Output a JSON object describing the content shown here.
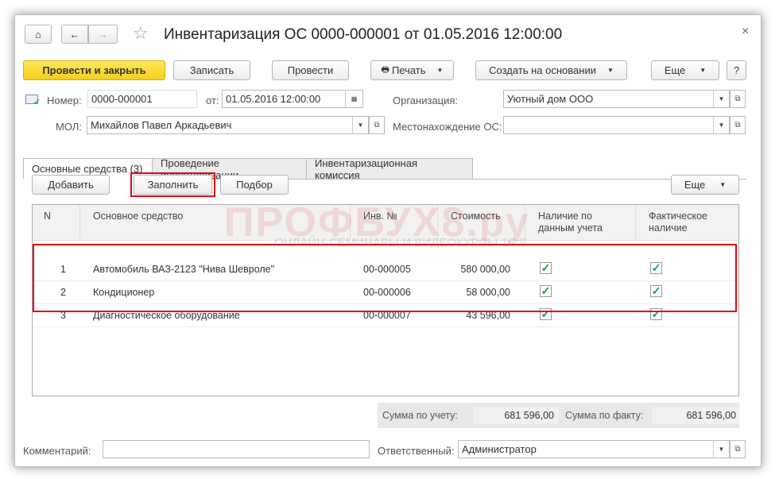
{
  "window": {
    "title": "Инвентаризация ОС 0000-000001 от 01.05.2016 12:00:00",
    "close": "×"
  },
  "toolbar": {
    "post_close": "Провести и закрыть",
    "save": "Записать",
    "post": "Провести",
    "print": "Печать",
    "create_based": "Создать на основании",
    "more": "Еще",
    "help": "?"
  },
  "header": {
    "number_label": "Номер:",
    "number": "0000-000001",
    "date_label": "от:",
    "date": "01.05.2016 12:00:00",
    "org_label": "Организация:",
    "org": "Уютный дом ООО",
    "mol_label": "МОЛ:",
    "mol": "Михайлов Павел Аркадьевич",
    "location_label": "Местонахождение ОС:",
    "location": ""
  },
  "tabs": [
    "Основные средства (3)",
    "Проведение инвентаризации",
    "Инвентаризационная комиссия"
  ],
  "table_toolbar": {
    "add": "Добавить",
    "fill": "Заполнить",
    "select": "Подбор",
    "more": "Еще"
  },
  "table": {
    "columns": [
      "N",
      "Основное средство",
      "Инв. №",
      "Стоимость",
      "Наличие по данным учета",
      "Фактическое наличие"
    ],
    "rows": [
      {
        "n": "1",
        "asset": "Автомобиль ВАЗ-2123 \"Нива Шевроле\"",
        "inv": "00-000005",
        "cost": "580 000,00",
        "book": true,
        "actual": true
      },
      {
        "n": "2",
        "asset": "Кондиционер",
        "inv": "00-000006",
        "cost": "58 000,00",
        "book": true,
        "actual": true
      },
      {
        "n": "3",
        "asset": "Диагностическое оборудование",
        "inv": "00-000007",
        "cost": "43 596,00",
        "book": true,
        "actual": true
      }
    ]
  },
  "totals": {
    "book_label": "Сумма по учету:",
    "book": "681 596,00",
    "actual_label": "Сумма по факту:",
    "actual": "681 596,00"
  },
  "footer": {
    "comment_label": "Комментарий:",
    "comment": "",
    "responsible_label": "Ответственный:",
    "responsible": "Администратор"
  },
  "watermark": {
    "logo": "ПРОФБУХ8.ру",
    "tagline": "ОНЛАЙН-СЕМИНАРЫ И ВИДЕОКУРСЫ 1С:8"
  },
  "colors": {
    "accent": "#f5cf1a",
    "highlight": "#e30613",
    "check": "#1a9a3a"
  }
}
